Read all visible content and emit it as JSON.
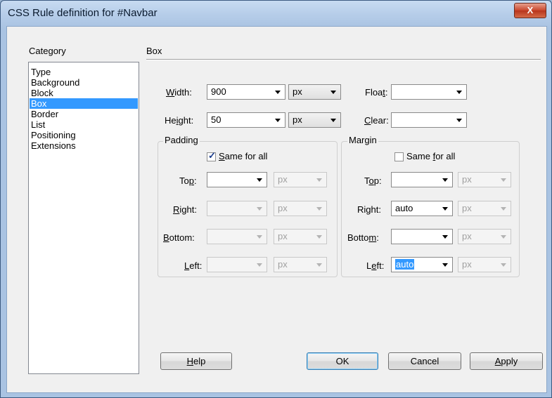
{
  "window": {
    "title": "CSS Rule definition for #Navbar",
    "close_glyph": "X"
  },
  "category": {
    "label": "Category",
    "items": [
      "Type",
      "Background",
      "Block",
      "Box",
      "Border",
      "List",
      "Positioning",
      "Extensions"
    ],
    "selected": "Box"
  },
  "section_title": "Box",
  "width": {
    "label_pre": "",
    "label_u": "W",
    "label_post": "idth:",
    "value": "900",
    "unit": "px"
  },
  "height": {
    "label_pre": "He",
    "label_u": "i",
    "label_post": "ght:",
    "value": "50",
    "unit": "px"
  },
  "float": {
    "label_pre": "Floa",
    "label_u": "t",
    "label_post": ":",
    "value": ""
  },
  "clear": {
    "label_pre": "",
    "label_u": "C",
    "label_post": "lear:",
    "value": ""
  },
  "padding": {
    "title": "Padding",
    "same_pre": "",
    "same_u": "S",
    "same_post": "ame for all",
    "same_checked": true,
    "top": {
      "pre": "To",
      "u": "p",
      "post": ":",
      "value": "",
      "unit": "px"
    },
    "right": {
      "pre": "",
      "u": "R",
      "post": "ight:",
      "value": "",
      "unit": "px"
    },
    "bottom": {
      "pre": "",
      "u": "B",
      "post": "ottom:",
      "value": "",
      "unit": "px"
    },
    "left": {
      "pre": "",
      "u": "L",
      "post": "eft:",
      "value": "",
      "unit": "px"
    }
  },
  "margin": {
    "title": "Margin",
    "same_pre": "Same ",
    "same_u": "f",
    "same_post": "or all",
    "same_checked": false,
    "top": {
      "pre": "T",
      "u": "o",
      "post": "p:",
      "value": "",
      "unit": "px"
    },
    "right": {
      "pre": "Ri",
      "u": "g",
      "post": "ht:",
      "value": "auto",
      "unit": "px"
    },
    "bottom": {
      "pre": "Botto",
      "u": "m",
      "post": ":",
      "value": "",
      "unit": "px"
    },
    "left": {
      "pre": "L",
      "u": "e",
      "post": "ft:",
      "value": "auto",
      "unit": "px"
    }
  },
  "buttons": {
    "help": {
      "pre": "",
      "u": "H",
      "post": "elp"
    },
    "ok": "OK",
    "cancel": "Cancel",
    "apply": {
      "pre": "",
      "u": "A",
      "post": "pply"
    }
  }
}
